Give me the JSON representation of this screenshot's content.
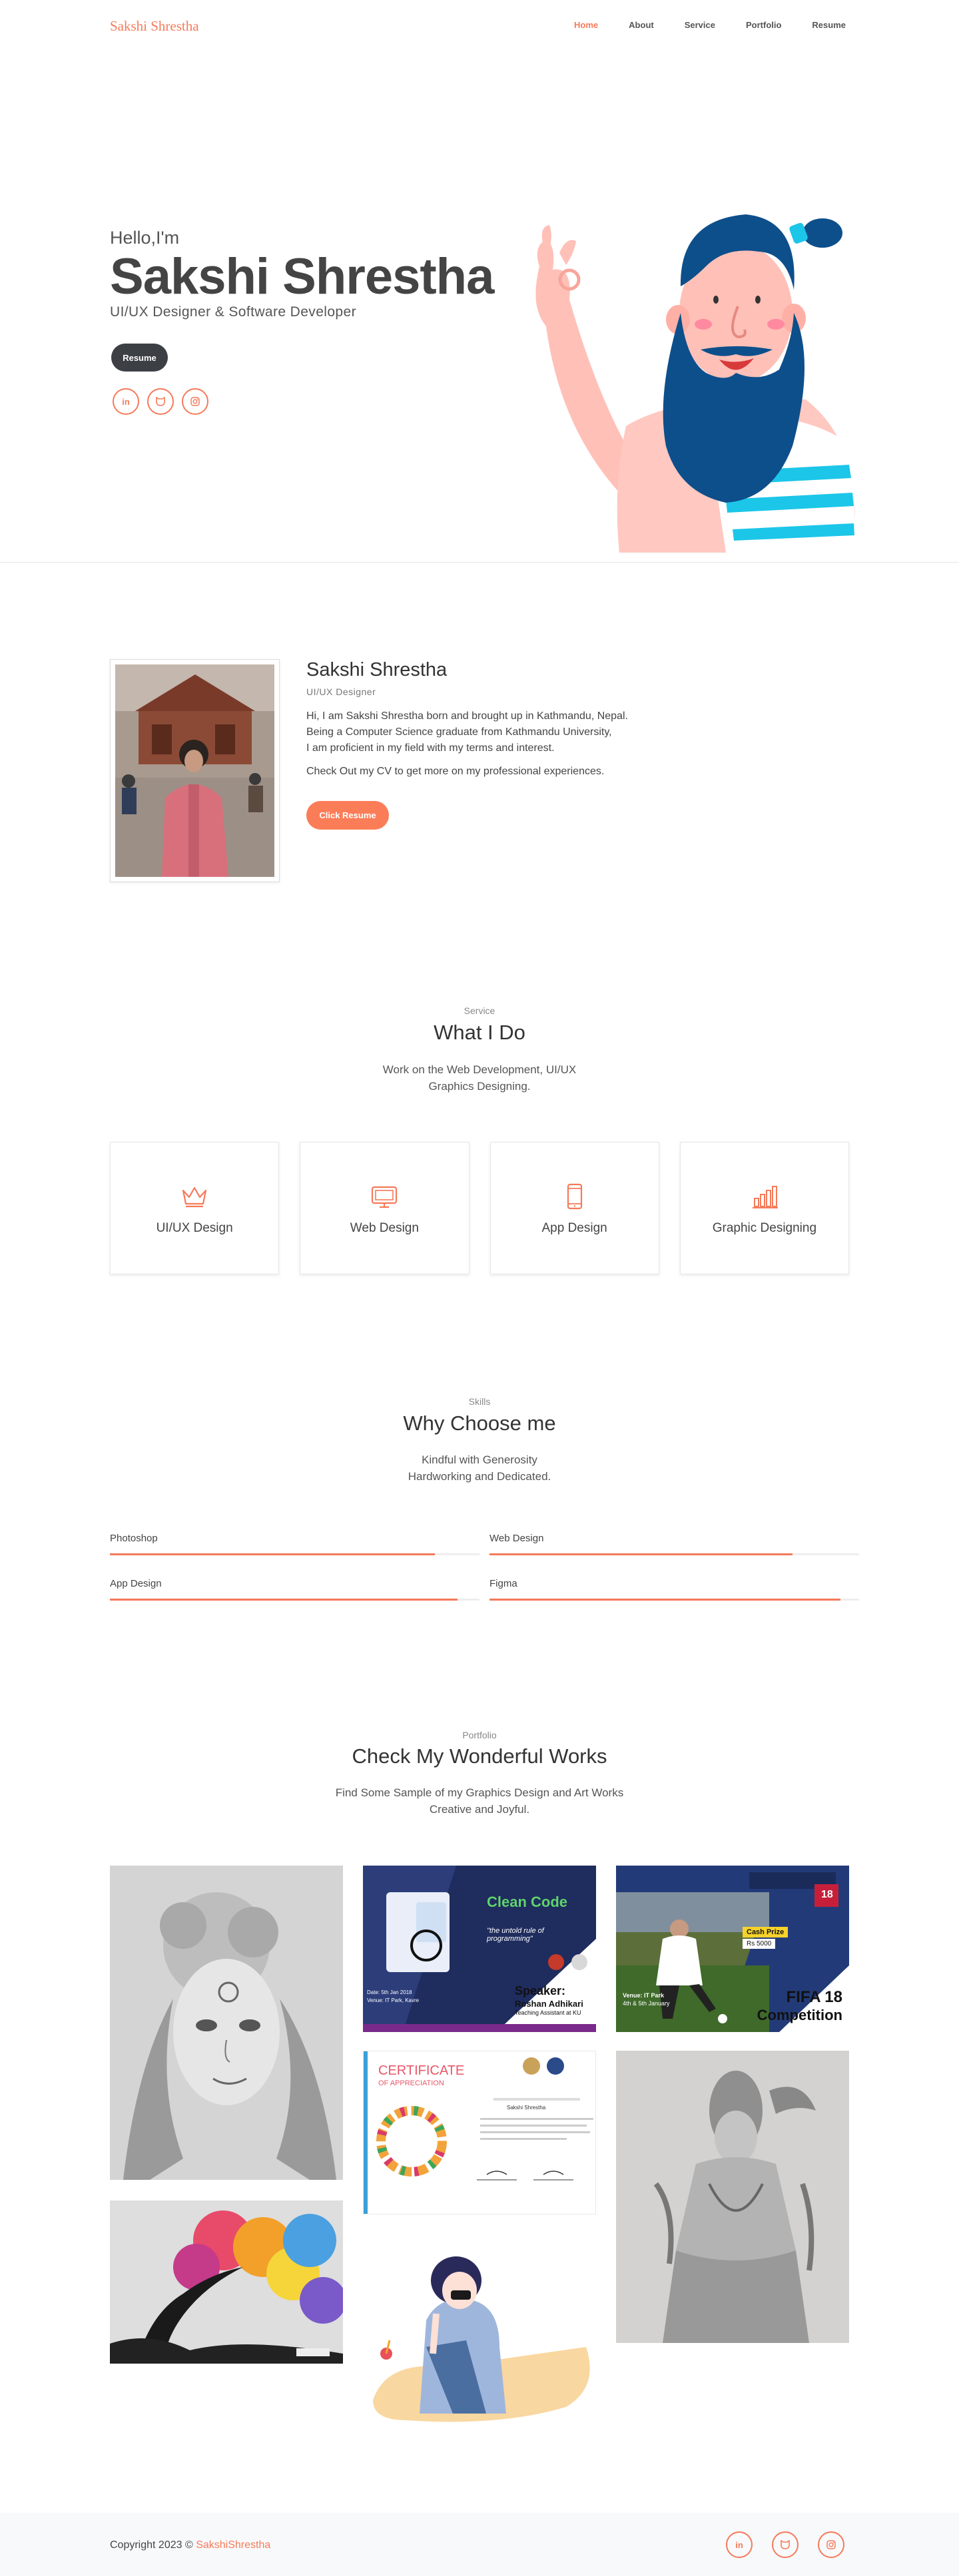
{
  "nav": {
    "brand": "Sakshi Shrestha",
    "items": [
      {
        "label": "Home",
        "active": true
      },
      {
        "label": "About",
        "active": false
      },
      {
        "label": "Service",
        "active": false
      },
      {
        "label": "Portfolio",
        "active": false
      },
      {
        "label": "Resume",
        "active": false
      }
    ]
  },
  "hero": {
    "greeting": "Hello,I'm",
    "name": "Sakshi Shrestha",
    "role": "UI/UX Designer & Software Developer",
    "resume_button": "Resume",
    "socials": [
      "linkedin-icon",
      "github-icon",
      "instagram-icon"
    ]
  },
  "about": {
    "name": "Sakshi Shrestha",
    "role": "UI/UX Designer",
    "bio": [
      "Hi, I am Sakshi Shrestha born and brought up in Kathmandu, Nepal.",
      "Being a Computer Science graduate from Kathmandu University,",
      "I am proficient in my field with my terms and interest."
    ],
    "cv_text": "Check Out my CV to get more on my professional experiences.",
    "cv_button": "Click Resume"
  },
  "services": {
    "tag": "Service",
    "title": "What I Do",
    "subtitle": [
      "Work on the Web Development, UI/UX",
      "Graphics Designing."
    ],
    "items": [
      {
        "label": "UI/UX Design",
        "icon": "crown-icon"
      },
      {
        "label": "Web Design",
        "icon": "monitor-icon"
      },
      {
        "label": "App Design",
        "icon": "mobile-icon"
      },
      {
        "label": "Graphic Designing",
        "icon": "chart-icon"
      }
    ]
  },
  "skills": {
    "tag": "Skills",
    "title": "Why Choose me",
    "subtitle": [
      "Kindful with Generosity",
      "Hardworking and Dedicated."
    ],
    "items": [
      {
        "label": "Photoshop",
        "level": 0.88
      },
      {
        "label": "Web Design",
        "level": 0.82
      },
      {
        "label": "App Design",
        "level": 0.94
      },
      {
        "label": "Figma",
        "level": 0.95
      }
    ]
  },
  "portfolio": {
    "tag": "Portfolio",
    "title": "Check My Wonderful Works",
    "subtitle": [
      "Find Some Sample of my Graphics Design and Art Works",
      "Creative and Joyful."
    ],
    "clean_code": {
      "title": "Clean Code",
      "tagline": "\"the untold rule of programming\"",
      "speaker_label": "Speaker:",
      "speaker": "Roshan Adhikari",
      "speaker_role": "Teaching Assistant at KU",
      "date": "Date: 5th Jan 2018",
      "venue": "Venue: IT Park, Kavre"
    },
    "fifa": {
      "title": "FIFA 18",
      "subtitle": "Competition",
      "cash_prize": "Cash Prize",
      "amount": "Rs 5000",
      "venue": "Venue: IT Park",
      "date": "4th & 5th January"
    },
    "certificate": {
      "title": "CERTIFICATE",
      "subtitle": "OF APPRECIATION",
      "recipient": "Sakshi Shrestha"
    }
  },
  "footer": {
    "copyright": "Copyright 2023 ©",
    "link": "SakshiShrestha",
    "socials": [
      "linkedin-icon",
      "github-icon",
      "instagram-icon"
    ]
  },
  "colors": {
    "accent": "#f57a5a",
    "dark": "#3c3f44",
    "beard": "#0d4f8b"
  }
}
